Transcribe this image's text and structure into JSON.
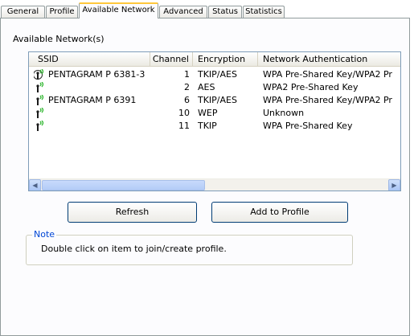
{
  "tabs": [
    {
      "label": "General"
    },
    {
      "label": "Profile"
    },
    {
      "label": "Available Network",
      "active": true
    },
    {
      "label": "Advanced"
    },
    {
      "label": "Status"
    },
    {
      "label": "Statistics"
    }
  ],
  "section_title": "Available Network(s)",
  "list": {
    "columns": [
      "SSID",
      "Channel",
      "Encryption",
      "Network Authentication"
    ],
    "rows": [
      {
        "ssid": "PENTAGRAM P 6381-3",
        "channel": "1",
        "encryption": "TKIP/AES",
        "auth": "WPA Pre-Shared Key/WPA2 Pr",
        "icon": "wifi-connected-icon"
      },
      {
        "ssid": "",
        "channel": "2",
        "encryption": "AES",
        "auth": "WPA2 Pre-Shared Key",
        "icon": "wifi-signal-icon"
      },
      {
        "ssid": "PENTAGRAM P 6391",
        "channel": "6",
        "encryption": "TKIP/AES",
        "auth": "WPA Pre-Shared Key/WPA2 Pr",
        "icon": "wifi-signal-icon"
      },
      {
        "ssid": "",
        "channel": "10",
        "encryption": "WEP",
        "auth": "Unknown",
        "icon": "wifi-signal-icon"
      },
      {
        "ssid": "",
        "channel": "11",
        "encryption": "TKIP",
        "auth": "WPA Pre-Shared Key",
        "icon": "wifi-signal-icon"
      }
    ]
  },
  "buttons": {
    "refresh": "Refresh",
    "add_to_profile": "Add to Profile"
  },
  "note": {
    "legend": "Note",
    "text": "Double click on item to join/create profile."
  },
  "colors": {
    "accent_tab": "#ffc83c",
    "note_legend": "#0046d5",
    "border": "#919b9c"
  }
}
